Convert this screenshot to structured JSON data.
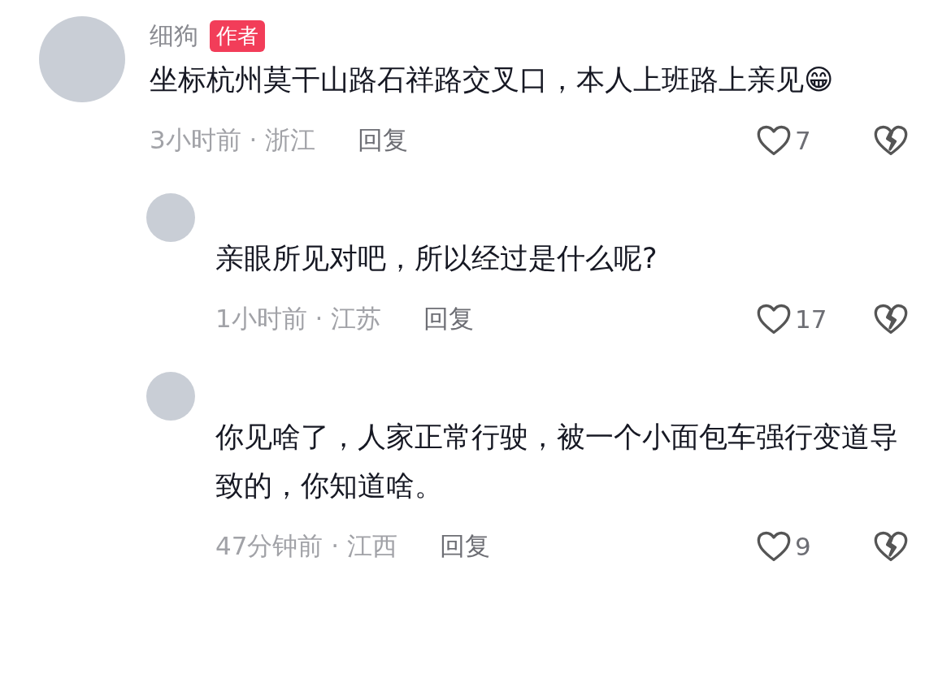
{
  "comments": [
    {
      "author": "细狗",
      "badge": "作者",
      "text": "坐标杭州莫干山路石祥路交叉口，本人上班路上亲见😁",
      "meta": "3小时前 · 浙江",
      "reply_label": "回复",
      "likes": "7",
      "replies": [
        {
          "text": "亲眼所见对吧，所以经过是什么呢?",
          "meta": "1小时前 · 江苏",
          "reply_label": "回复",
          "likes": "17"
        },
        {
          "text": "你见啥了，人家正常行驶，被一个小面包车强行变道导致的，你知道啥。",
          "meta": "47分钟前 · 江西",
          "reply_label": "回复",
          "likes": "9"
        }
      ]
    }
  ]
}
